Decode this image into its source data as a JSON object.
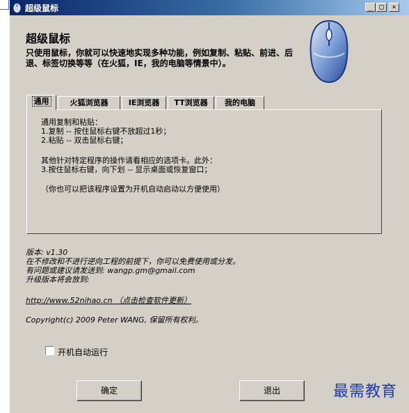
{
  "window": {
    "title": "超级鼠标",
    "buttons": {
      "minimize": "_",
      "maximize": "□",
      "close": "×"
    }
  },
  "header": {
    "app_name": "超级鼠标",
    "description": "只使用鼠标，你就可以快速地实现多种功能，例如复制、粘贴、前进、后退、标签切换等等（在火狐，IE，我的电脑等情景中）。",
    "image_icon": "mouse-icon"
  },
  "tabs": [
    {
      "label": "通用",
      "active": true
    },
    {
      "label": "火狐浏览器",
      "active": false
    },
    {
      "label": "IE浏览器",
      "active": false
    },
    {
      "label": "TT浏览器",
      "active": false
    },
    {
      "label": "我的电脑",
      "active": false
    }
  ],
  "panel": {
    "lines": [
      "通用复制和粘贴：",
      "1.复制 -- 按住鼠标右键不放超过1秒；",
      "2.粘贴 -- 双击鼠标右键；",
      "其他针对特定程序的操作请看相应的选项卡。此外：",
      "3.按住鼠标右键，向下划 -- 显示桌面或恢复窗口；",
      "（你也可以把该程序设置为开机自动启动以方便使用）"
    ]
  },
  "info": {
    "version": "版本: v1.30",
    "license": "在不修改和不进行逆向工程的前提下，你可以免费使用或分发。",
    "contact": "有问题或建议请发送到: wangp.gm@gmail.com",
    "release": "升级版本将会放到:",
    "link": "http://www.52nihao.cn （点击检查软件更新）",
    "copyright": "Copyright(c) 2009 Peter WANG, 保留所有权利。"
  },
  "autostart": {
    "label": "开机自动运行",
    "checked": false
  },
  "footer": {
    "ok_label": "确定",
    "exit_label": "退出"
  },
  "watermark": "最需教育",
  "colors": {
    "face": "#d4d0c8",
    "title_start": "#0a246a",
    "title_end": "#a6caf0",
    "watermark": "#1e3aa8"
  }
}
